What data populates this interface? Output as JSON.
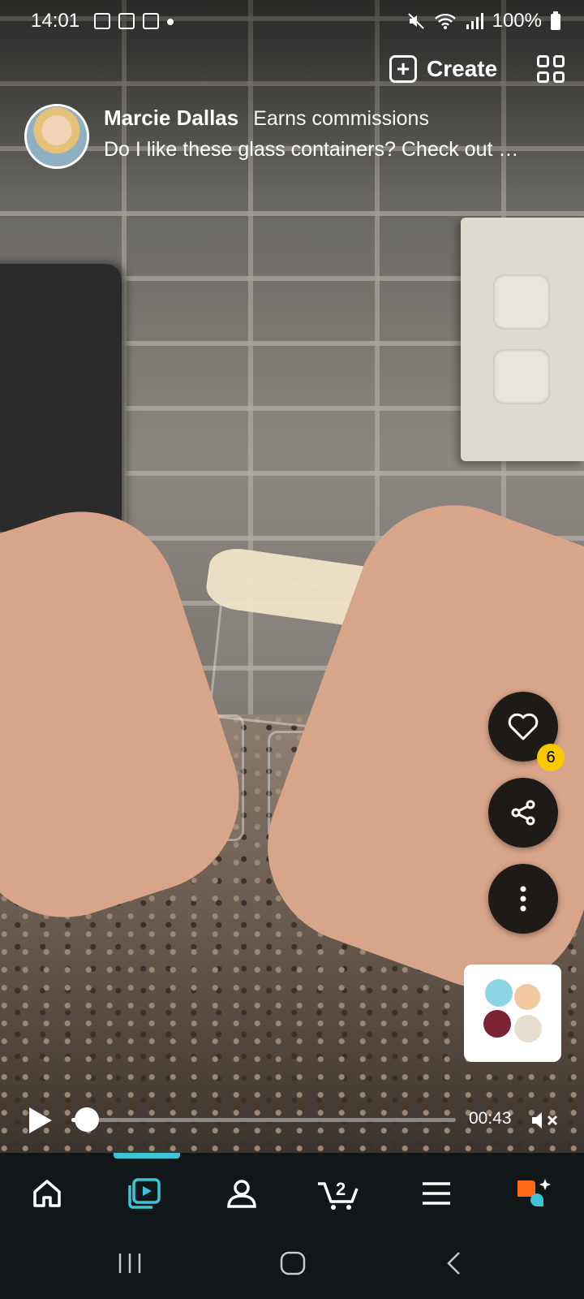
{
  "status_bar": {
    "time": "14:01",
    "battery": "100%"
  },
  "header": {
    "create_label": "Create"
  },
  "post": {
    "author": "Marcie Dallas",
    "tag": "Earns commissions",
    "caption": "Do I like these glass containers? Check out …",
    "likes": "6"
  },
  "player": {
    "time": "00:43",
    "progress": 0.04
  },
  "nav": {
    "cart_count": "2",
    "items": [
      "home-icon",
      "video-icon",
      "account-icon",
      "cart-icon",
      "menu-icon",
      "assistant-icon"
    ]
  },
  "colors": {
    "accent": "#3ec4d6",
    "badge": "#f9c800",
    "nav_bg": "#111619"
  }
}
